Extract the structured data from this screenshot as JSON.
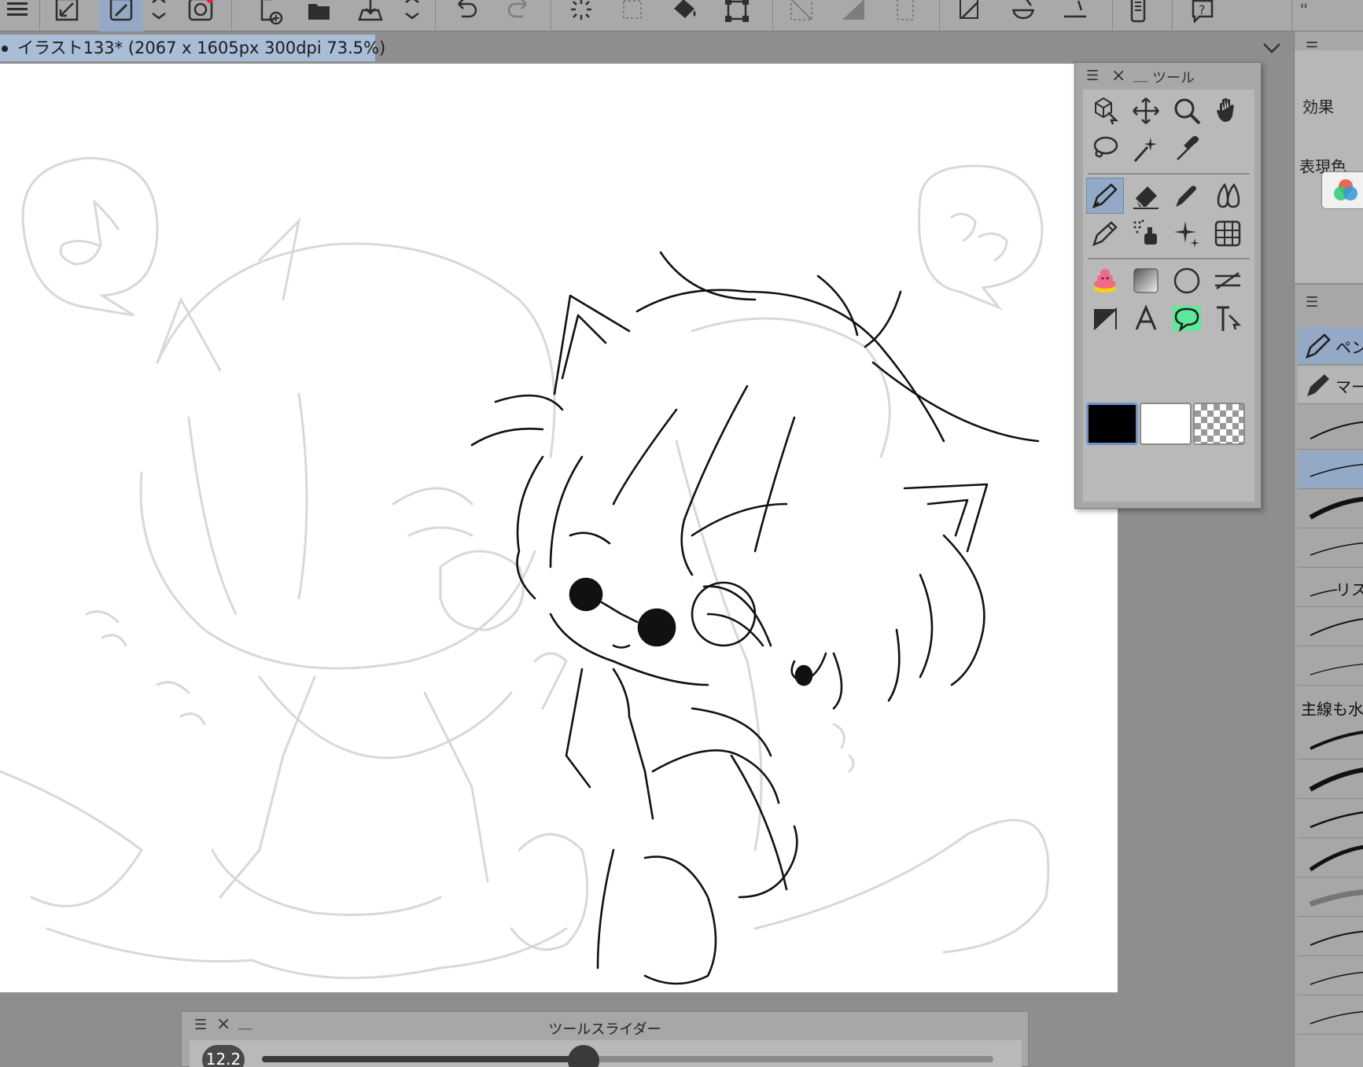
{
  "document": {
    "tab_title": "イラスト133* (2067 x 1605px 300dpi 73.5%)"
  },
  "tool_palette": {
    "title": "ツール",
    "selected_tool": "pen",
    "colors": {
      "main": "#000000",
      "sub": "#ffffff",
      "transparent": "checker"
    }
  },
  "effect_panel": {
    "effect_label": "効果",
    "expression_color_label": "表現色"
  },
  "brush_panel": {
    "items": [
      {
        "label": "ペン",
        "icon": "pen-icon",
        "selected": true
      },
      {
        "label": "マー",
        "icon": "marker-icon",
        "selected": false
      }
    ],
    "labeled_strokes": [
      {
        "label": "リス"
      }
    ],
    "group_label": "主線も水"
  },
  "tool_slider": {
    "title": "ツールスライダー",
    "value": "12.2",
    "fill_fraction": 0.44
  },
  "accent": {
    "selection_blue": "#93a9c6",
    "balloon_green": "#5ee89b"
  }
}
